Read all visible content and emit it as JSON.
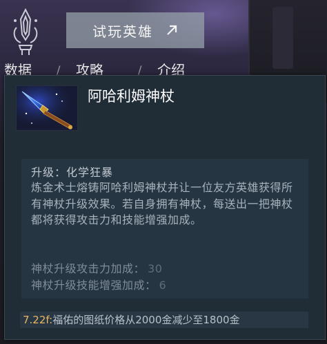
{
  "header": {
    "try_hero_label": "试玩英雄",
    "tabs": [
      {
        "label": "数据"
      },
      {
        "label": "攻略"
      },
      {
        "label": "介绍"
      }
    ]
  },
  "tooltip": {
    "item_name": "阿哈利姆神杖",
    "upgrade_title": "升级：化学狂暴",
    "upgrade_description": "炼金术士熔铸阿哈利姆神杖并让一位友方英雄获得所有神杖升级效果。若自身拥有神杖，每送出一把神杖都将获得攻击力和技能增强加成。",
    "stats": [
      {
        "label": "神杖升级攻击力加成：",
        "value": "30"
      },
      {
        "label": "神杖升级技能增强加成：",
        "value": "6"
      }
    ],
    "patch_version": "7.22f:",
    "patch_text": "福佑的图纸价格从2000金减少至1800金"
  },
  "icons": {
    "emblem": "hero-attribute-emblem-icon",
    "arrow": "external-arrow-icon",
    "item": "aghanims-scepter-icon"
  },
  "colors": {
    "patch_version": "#e9b864",
    "tooltip_bg": "#202d37",
    "panel_bg": "#263542"
  }
}
